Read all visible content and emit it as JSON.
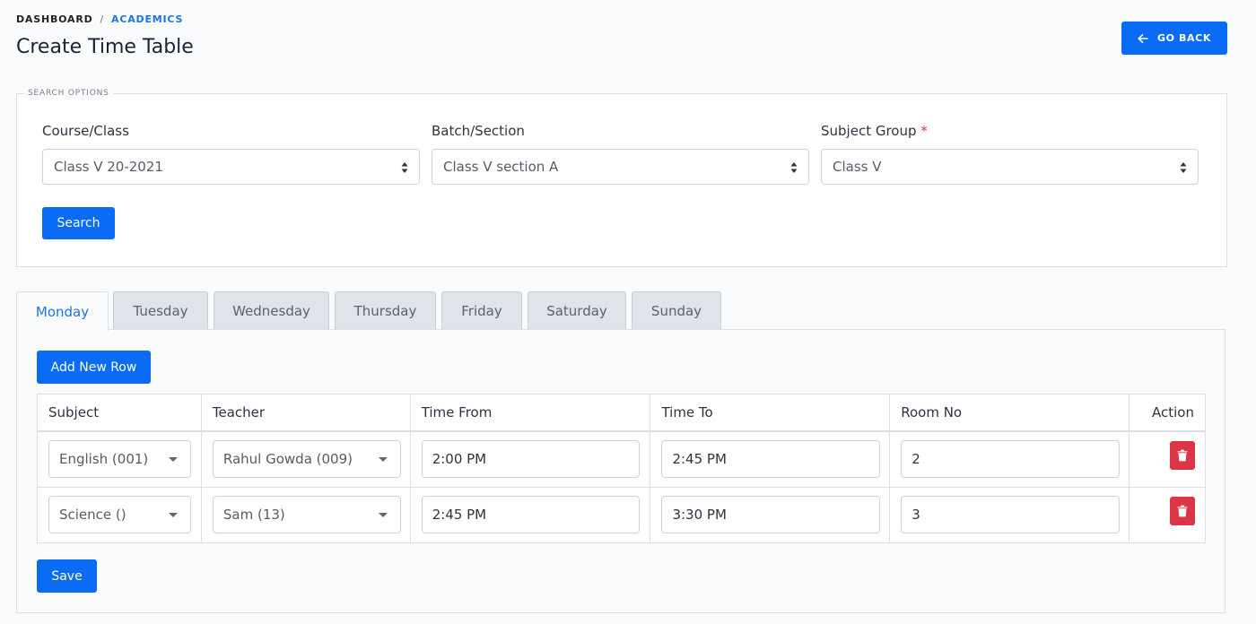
{
  "breadcrumb": {
    "root": "DASHBOARD",
    "separator": "/",
    "current": "ACADEMICS"
  },
  "page_title": "Create Time Table",
  "go_back_label": "GO BACK",
  "search_options": {
    "legend": "SEARCH OPTIONS",
    "course_label": "Course/Class",
    "course_value": "Class V 20-2021",
    "batch_label": "Batch/Section",
    "batch_value": "Class V section A",
    "subject_group_label": "Subject Group",
    "subject_group_required": "*",
    "subject_group_value": "Class V",
    "search_label": "Search"
  },
  "tabs": [
    "Monday",
    "Tuesday",
    "Wednesday",
    "Thursday",
    "Friday",
    "Saturday",
    "Sunday"
  ],
  "active_tab": "Monday",
  "add_row_label": "Add New Row",
  "table": {
    "headers": [
      "Subject",
      "Teacher",
      "Time From",
      "Time To",
      "Room No",
      "Action"
    ],
    "rows": [
      {
        "subject": "English (001)",
        "teacher": "Rahul Gowda (009)",
        "time_from": "2:00 PM",
        "time_to": "2:45 PM",
        "room": "2"
      },
      {
        "subject": "Science ()",
        "teacher": "Sam (13)",
        "time_from": "2:45 PM",
        "time_to": "3:30 PM",
        "room": "3"
      }
    ]
  },
  "save_label": "Save",
  "colors": {
    "primary": "#0a6cf5",
    "danger": "#dc3545",
    "active_tab_text": "#1a73e8"
  }
}
